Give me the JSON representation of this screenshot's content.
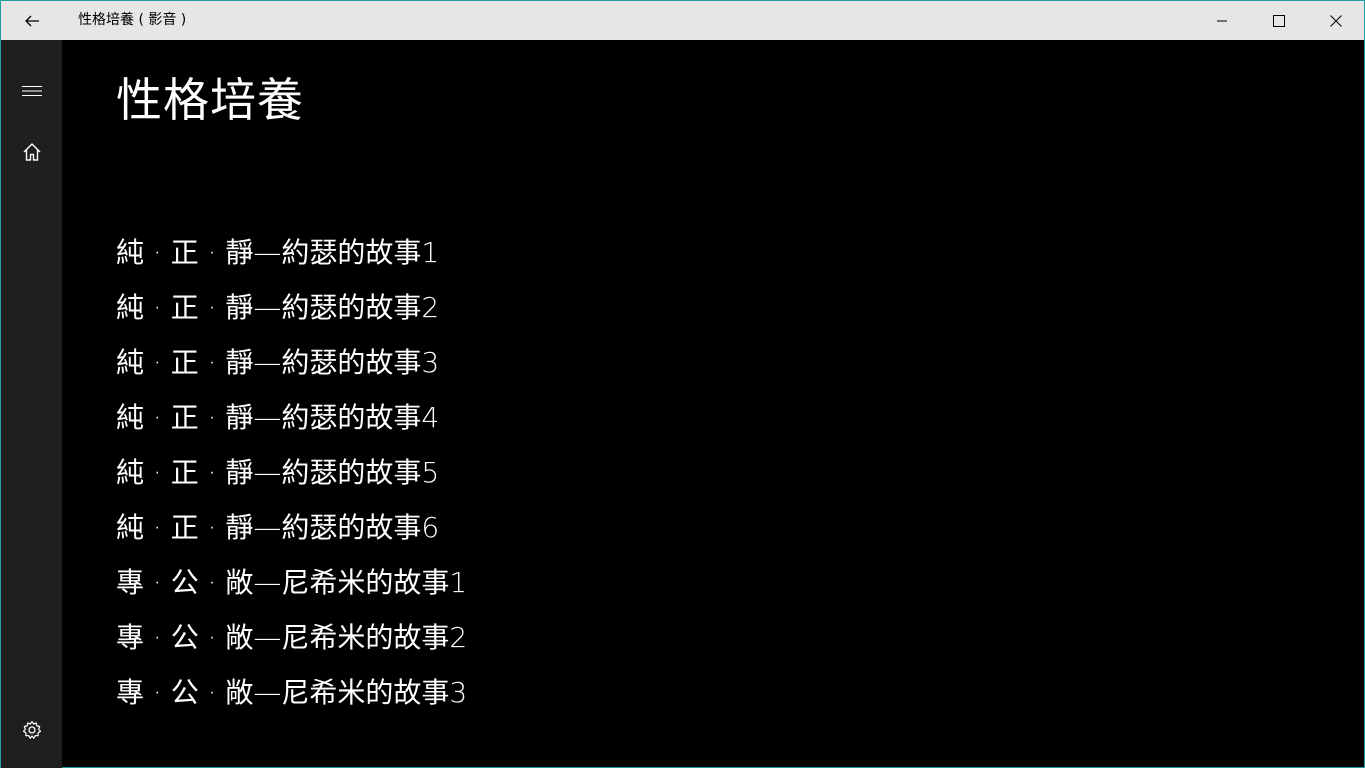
{
  "window": {
    "title": "性格培養 ( 影音 )"
  },
  "titlebar": {
    "back_icon": "arrow-left-icon",
    "minimize_icon": "minimize-icon",
    "maximize_icon": "maximize-icon",
    "close_icon": "close-icon"
  },
  "sidebar": {
    "menu_icon": "hamburger-menu-icon",
    "home_icon": "home-icon",
    "settings_icon": "gear-icon"
  },
  "page": {
    "title": "性格培養"
  },
  "items": [
    "純 · 正 · 靜—約瑟的故事1",
    "純 · 正 · 靜—約瑟的故事2",
    "純 · 正 · 靜—約瑟的故事3",
    "純 · 正 · 靜—約瑟的故事4",
    "純 · 正 · 靜—約瑟的故事5",
    "純 · 正 · 靜—約瑟的故事6",
    "專 · 公 · 敞—尼希米的故事1",
    "專 · 公 · 敞—尼希米的故事2",
    "專 · 公 · 敞—尼希米的故事3"
  ],
  "colors": {
    "titlebar_bg": "#e6e6e6",
    "sidebar_bg": "#1f1f1f",
    "content_bg": "#000000",
    "text": "#ffffff",
    "window_border": "#1ba1a1"
  }
}
